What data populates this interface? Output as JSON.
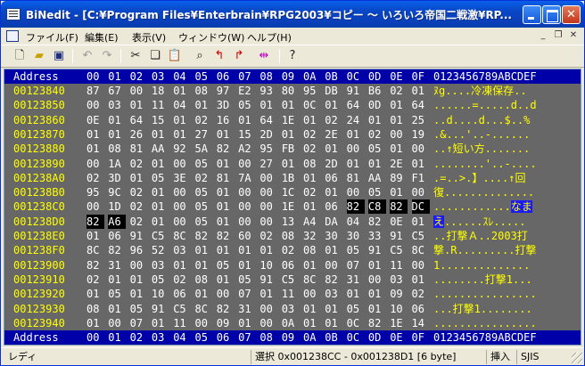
{
  "window": {
    "title": "BiNedit - [C:¥Program Files¥Enterbrain¥RPG2003¥コピー ～ いろいろ帝国二戦激¥RP..."
  },
  "menu": [
    "ファイル(F)",
    "編集(E)",
    "表示(V)",
    "ウィンドウ(W)",
    "ヘルプ(H)"
  ],
  "toolbar": {
    "tools": [
      "new-file",
      "open-folder",
      "save",
      "undo",
      "redo",
      "cut",
      "copy",
      "paste",
      "find",
      "find-prev",
      "find-next",
      "bookmark",
      "help"
    ]
  },
  "hex": {
    "header_addr": "Address",
    "header_cols": [
      "00",
      "01",
      "02",
      "03",
      "04",
      "05",
      "06",
      "07",
      "08",
      "09",
      "0A",
      "0B",
      "0C",
      "0D",
      "0E",
      "0F"
    ],
    "header_ascii": "0123456789ABCDEF",
    "rows": [
      {
        "addr": "00123840",
        "bytes": [
          "87",
          "67",
          "00",
          "18",
          "01",
          "08",
          "97",
          "E2",
          "93",
          "80",
          "95",
          "DB",
          "91",
          "B6",
          "02",
          "01"
        ],
        "ascii": "ﾇg....冷凍保存..",
        "sel": [],
        "asel": ""
      },
      {
        "addr": "00123850",
        "bytes": [
          "00",
          "03",
          "01",
          "11",
          "04",
          "01",
          "3D",
          "05",
          "01",
          "01",
          "0C",
          "01",
          "64",
          "0D",
          "01",
          "64"
        ],
        "ascii": "......=.....d..d",
        "sel": [],
        "asel": ""
      },
      {
        "addr": "00123860",
        "bytes": [
          "0E",
          "01",
          "64",
          "15",
          "01",
          "02",
          "16",
          "01",
          "64",
          "1E",
          "01",
          "02",
          "24",
          "01",
          "01",
          "25"
        ],
        "ascii": "..d....d...$..%",
        "sel": [],
        "asel": ""
      },
      {
        "addr": "00123870",
        "bytes": [
          "01",
          "01",
          "26",
          "01",
          "01",
          "27",
          "01",
          "15",
          "2D",
          "01",
          "02",
          "2E",
          "01",
          "02",
          "00",
          "19"
        ],
        "ascii": ".&...'..-......",
        "sel": [],
        "asel": ""
      },
      {
        "addr": "00123880",
        "bytes": [
          "01",
          "08",
          "81",
          "AA",
          "92",
          "5A",
          "82",
          "A2",
          "95",
          "FB",
          "02",
          "01",
          "00",
          "05",
          "01",
          "00"
        ],
        "ascii": "..↑短い方.......",
        "sel": [],
        "asel": ""
      },
      {
        "addr": "00123890",
        "bytes": [
          "00",
          "1A",
          "02",
          "01",
          "00",
          "05",
          "01",
          "00",
          "27",
          "01",
          "08",
          "2D",
          "01",
          "01",
          "2E",
          "01"
        ],
        "ascii": "........'..-....",
        "sel": [],
        "asel": ""
      },
      {
        "addr": "001238A0",
        "bytes": [
          "02",
          "3D",
          "01",
          "05",
          "3E",
          "02",
          "81",
          "7A",
          "00",
          "1B",
          "01",
          "06",
          "81",
          "AA",
          "89",
          "F1"
        ],
        "ascii": ".=..>.】....↑回",
        "sel": [],
        "asel": ""
      },
      {
        "addr": "001238B0",
        "bytes": [
          "95",
          "9C",
          "02",
          "01",
          "00",
          "05",
          "01",
          "00",
          "00",
          "1C",
          "02",
          "01",
          "00",
          "05",
          "01",
          "00"
        ],
        "ascii": "復..............",
        "sel": [],
        "asel": ""
      },
      {
        "addr": "001238C0",
        "bytes": [
          "00",
          "1D",
          "02",
          "01",
          "00",
          "05",
          "01",
          "00",
          "00",
          "1E",
          "01",
          "06",
          "82",
          "C8",
          "82",
          "DC"
        ],
        "ascii": "............",
        "sel": [
          12,
          13,
          14,
          15
        ],
        "asel": "なま"
      },
      {
        "addr": "001238D0",
        "bytes": [
          "82",
          "A6",
          "02",
          "01",
          "00",
          "05",
          "01",
          "00",
          "00",
          "13",
          "A4",
          "DA",
          "04",
          "82",
          "0E",
          "01"
        ],
        "ascii": "......ｽﾚ.....",
        "sel": [
          0,
          1
        ],
        "asel": "え",
        "asel_first": true
      },
      {
        "addr": "001238E0",
        "bytes": [
          "01",
          "06",
          "91",
          "C5",
          "8C",
          "82",
          "82",
          "60",
          "02",
          "08",
          "32",
          "30",
          "30",
          "33",
          "91",
          "C5"
        ],
        "ascii": "..打撃Ａ..2003打",
        "sel": [],
        "asel": ""
      },
      {
        "addr": "001238F0",
        "bytes": [
          "8C",
          "82",
          "96",
          "52",
          "03",
          "01",
          "01",
          "01",
          "01",
          "02",
          "08",
          "01",
          "05",
          "91",
          "C5",
          "8C"
        ],
        "ascii": "撃.R.........打撃",
        "sel": [],
        "asel": ""
      },
      {
        "addr": "00123900",
        "bytes": [
          "82",
          "31",
          "00",
          "03",
          "01",
          "01",
          "05",
          "01",
          "10",
          "06",
          "01",
          "00",
          "07",
          "01",
          "11",
          "00"
        ],
        "ascii": "1..............",
        "sel": [],
        "asel": ""
      },
      {
        "addr": "00123910",
        "bytes": [
          "02",
          "01",
          "01",
          "05",
          "02",
          "08",
          "01",
          "05",
          "91",
          "C5",
          "8C",
          "82",
          "31",
          "00",
          "03",
          "01"
        ],
        "ascii": "........打撃1...",
        "sel": [],
        "asel": ""
      },
      {
        "addr": "00123920",
        "bytes": [
          "01",
          "05",
          "01",
          "10",
          "06",
          "01",
          "00",
          "07",
          "01",
          "11",
          "00",
          "03",
          "01",
          "01",
          "09",
          "02"
        ],
        "ascii": "................",
        "sel": [],
        "asel": ""
      },
      {
        "addr": "00123930",
        "bytes": [
          "08",
          "01",
          "05",
          "91",
          "C5",
          "8C",
          "82",
          "31",
          "00",
          "03",
          "01",
          "01",
          "05",
          "01",
          "10",
          "06"
        ],
        "ascii": "...打撃1........",
        "sel": [],
        "asel": ""
      },
      {
        "addr": "00123940",
        "bytes": [
          "01",
          "00",
          "07",
          "01",
          "11",
          "00",
          "09",
          "01",
          "00",
          "0A",
          "01",
          "01",
          "0C",
          "82",
          "1E",
          "14"
        ],
        "ascii": "................",
        "sel": [],
        "asel": ""
      }
    ],
    "footer_addr": "Address",
    "footer_ascii": "0123456789ABCDEF"
  },
  "status": {
    "left": "レディ",
    "selection": "選択 0x001238CC - 0x001238D1 [6 byte]",
    "mode": "挿入",
    "encoding": "SJIS"
  },
  "colors": {
    "title_bar": "#0846c4",
    "hex_background": "#676767",
    "header_band": "#0000a8",
    "address_text": "#ffff00",
    "ascii_text": "#ffff00",
    "selection": "#000000"
  }
}
